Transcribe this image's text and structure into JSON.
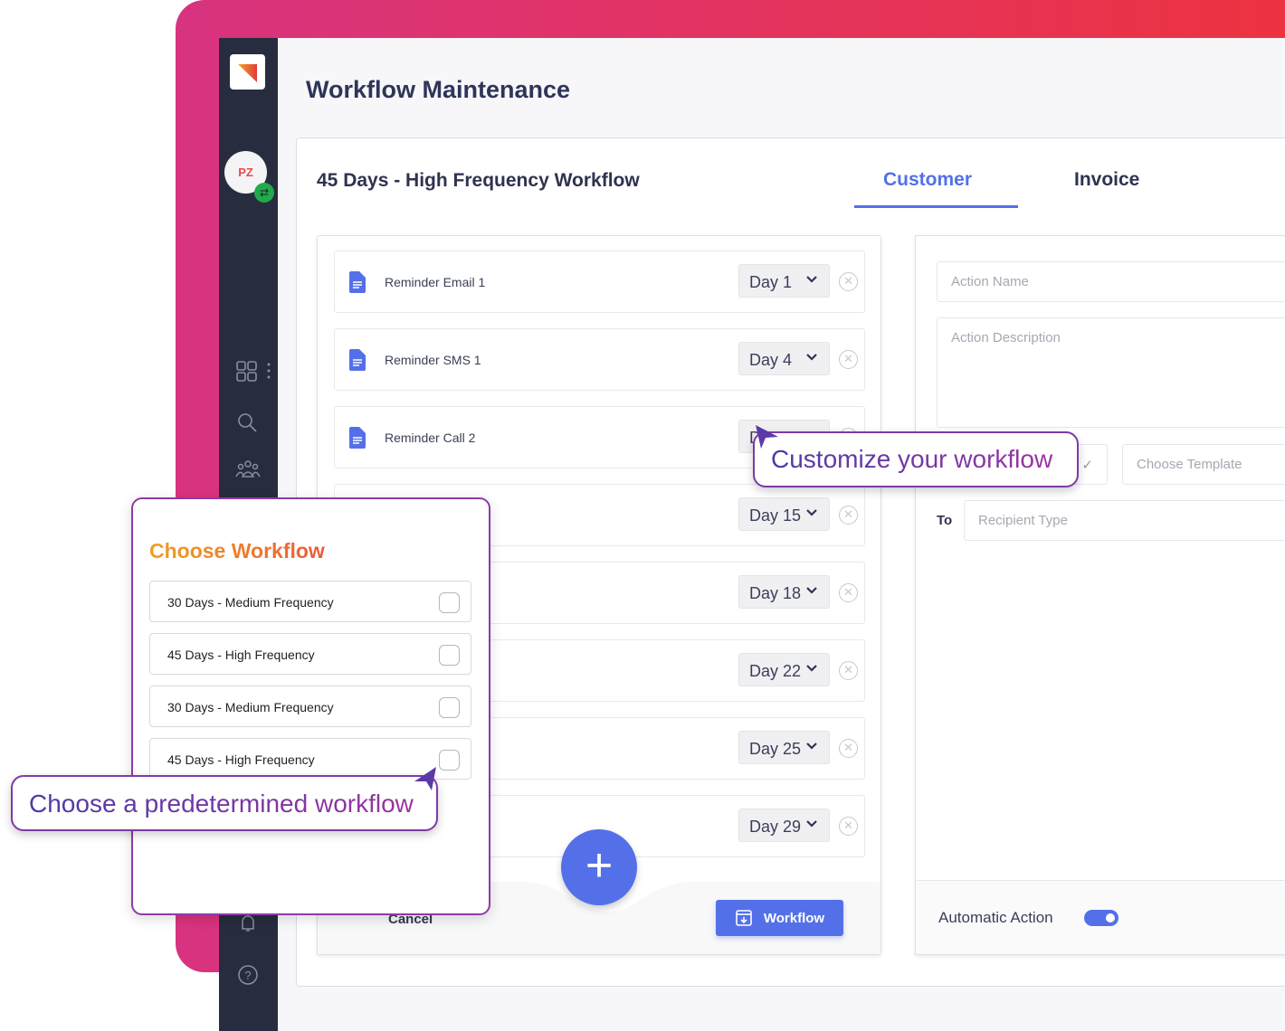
{
  "app": {
    "title": "Workflow Maintenance",
    "user_initials": "PZ"
  },
  "workflow": {
    "title": "45 Days - High Frequency Workflow",
    "tabs": [
      {
        "label": "Customer",
        "active": true
      },
      {
        "label": "Invoice",
        "active": false
      }
    ]
  },
  "actions": [
    {
      "name": "Reminder Email 1",
      "day": "Day 1"
    },
    {
      "name": "Reminder SMS 1",
      "day": "Day 4"
    },
    {
      "name": "Reminder Call 2",
      "day": "D"
    },
    {
      "name": "",
      "day": "Day 15"
    },
    {
      "name": "",
      "day": "Day 18"
    },
    {
      "name": "",
      "day": "Day 22"
    },
    {
      "name": "",
      "day": "Day 25"
    },
    {
      "name": "",
      "day": "Day 29"
    }
  ],
  "footer": {
    "cancel": "Cancel",
    "workflow_button": "Workflow"
  },
  "form": {
    "action_name_placeholder": "Action Name",
    "action_description_placeholder": "Action Description",
    "template_placeholder": "Choose Template",
    "to_label": "To",
    "recipient_placeholder": "Recipient Type",
    "automatic_action_label": "Automatic Action",
    "automatic_action_on": true
  },
  "chooser": {
    "title": "Choose Workflow",
    "options": [
      "30 Days - Medium Frequency",
      "45 Days - High Frequency",
      "30 Days - Medium Frequency",
      "45 Days - High Frequency"
    ]
  },
  "callouts": {
    "customize": "Customize your workflow",
    "predetermined": "Choose a predetermined workflow"
  },
  "colors": {
    "accent": "#5470e8",
    "sidebar": "#272d3f",
    "callout": "#8e3aa8",
    "gradient_start": "#d8337f",
    "gradient_end": "#ee3340"
  }
}
